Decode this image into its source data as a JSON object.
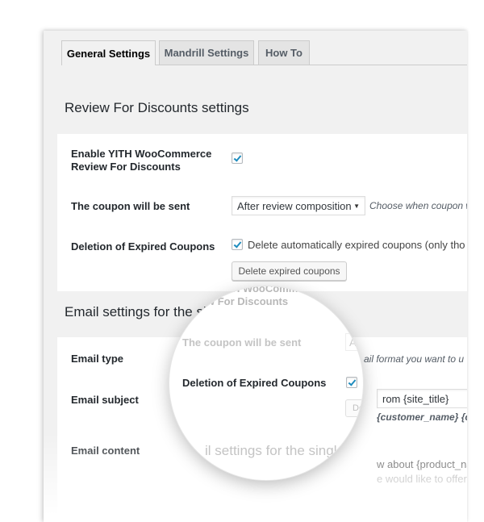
{
  "tabs": [
    {
      "label": "General Settings",
      "active": true
    },
    {
      "label": "Mandrill Settings",
      "active": false
    },
    {
      "label": "How To",
      "active": false
    }
  ],
  "review_section": {
    "title": "Review For Discounts settings",
    "enable_label": "Enable YITH WooCommerce Review For Discounts",
    "enable_checked": true,
    "coupon_sent_label": "The coupon will be sent",
    "coupon_sent_value": "After review composition",
    "coupon_sent_desc": "Choose when coupon w",
    "deletion_label": "Deletion of Expired Coupons",
    "deletion_checked": true,
    "deletion_desc": "Delete automatically expired coupons (only tho",
    "delete_button": "Delete expired coupons"
  },
  "email_section": {
    "title": "Email settings for the sin",
    "type_label": "Email type",
    "type_desc": "ail format you want to u",
    "subject_label": "Email subject",
    "subject_value": "rom {site_title}",
    "subject_hint": "{customer_name} {custo",
    "content_label": "Email content",
    "content_line1": "w about {product_name}!",
    "content_line2": "e would like to offer you this co"
  },
  "magnifier": {
    "top_text1": "TH WooCommerce",
    "top_text2": "w For Discounts",
    "faded_label": "The coupon will be sent",
    "faded_value": "Af",
    "focus_label": "Deletion of Expired Coupons",
    "focus_checked": true,
    "focus_desc": "D",
    "faded_button": "De",
    "bottom_text": "il settings for the single r"
  },
  "colors": {
    "accent_check": "#1e8cbe",
    "panel_bg": "#f1f1f1",
    "card_bg": "#ffffff"
  }
}
